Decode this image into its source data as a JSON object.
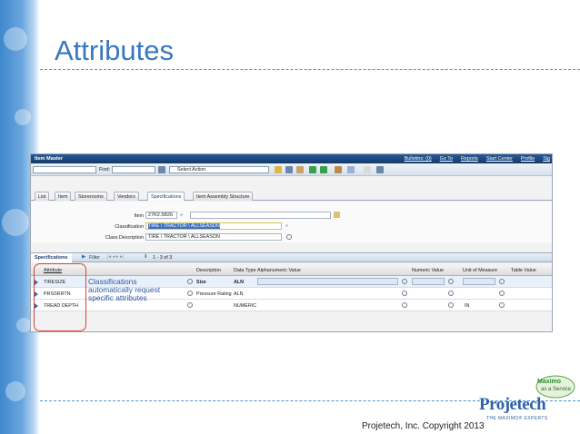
{
  "slide": {
    "title": "Attributes",
    "copyright": "Projetech, Inc. Copyright 2013",
    "logo": {
      "brand": "Projetech",
      "tagline": "THE MAXIMO® EXPERTS",
      "badge_title": "Maximo",
      "badge_sub": "as a Service"
    }
  },
  "app": {
    "window_title": "Item Master",
    "top_links": [
      "Bulletins: (0)",
      "Go To",
      "Reports",
      "Start Center",
      "Profile",
      "Sig"
    ],
    "toolbar": {
      "find_label": "Find:",
      "select_action": "Select Action"
    },
    "tabs": [
      {
        "label": "List"
      },
      {
        "label": "Item"
      },
      {
        "label": "Storerooms"
      },
      {
        "label": "Vendors"
      },
      {
        "label": "Specifications"
      },
      {
        "label": "Item Assembly Structure"
      }
    ],
    "form": {
      "item_label": "Item",
      "item_value": "27R2.5B26",
      "classification_label": "Classification",
      "classification_value": "TIRE \\ TRACTOR \\ ALLSEASON",
      "class_desc_label": "Class Description",
      "class_desc_value": "TIRE \\ TRACTOR \\ ALLSEASON"
    },
    "spec_bar": {
      "tab": "Specifications",
      "filter": "Filter",
      "pager": "1 - 3 of 3"
    },
    "grid": {
      "columns": [
        "Attribute",
        "Description",
        "Data Type",
        "Alphanumeric Value",
        "Numeric Value",
        "Unit of Measure",
        "Table Value"
      ],
      "rows": [
        {
          "attribute": "TIRESIZE",
          "description": "Size",
          "data_type": "ALN",
          "alnvalue": "",
          "numvalue": "",
          "uom": ""
        },
        {
          "attribute": "PRSSRRTN",
          "description": "Pressure Rating",
          "data_type": "ALN",
          "alnvalue": "",
          "numvalue": "",
          "uom": ""
        },
        {
          "attribute": "TREAD DEPTH",
          "description": "",
          "data_type": "NUMERIC",
          "alnvalue": "",
          "numvalue": "",
          "uom": "IN"
        }
      ]
    }
  },
  "annotation": {
    "lines": [
      "Classifications",
      "automatically request",
      "specific attributes"
    ]
  },
  "colors": {
    "title": "#3a78bd",
    "accent_blue": "#2d57a8",
    "highlight": "#d9413e"
  }
}
